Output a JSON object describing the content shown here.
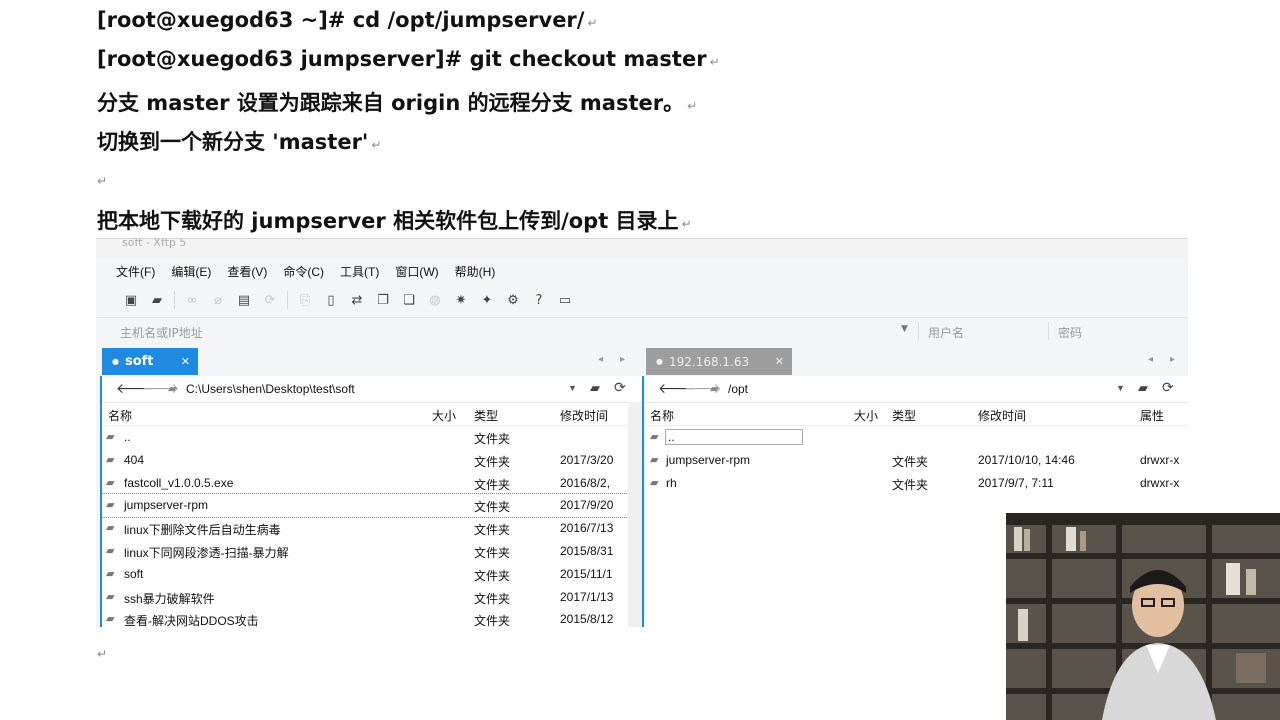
{
  "doc": {
    "line1": "[root@xuegod63 ~]# cd /opt/jumpserver/",
    "line2": "[root@xuegod63 jumpserver]# git checkout master",
    "line3": "分支 master 设置为跟踪来自 origin 的远程分支 master。",
    "line4": "切换到一个新分支 'master'",
    "line5": "把本地下载好的 jumpserver 相关软件包上传到/opt 目录上",
    "para_mark": "↵"
  },
  "xftp": {
    "title": "soft - Xftp 5",
    "menu": [
      "文件(F)",
      "编辑(E)",
      "查看(V)",
      "命令(C)",
      "工具(T)",
      "窗口(W)",
      "帮助(H)"
    ],
    "address": {
      "host_placeholder": "主机名或IP地址",
      "user_placeholder": "用户名",
      "password_placeholder": "密码"
    },
    "left": {
      "tab": "soft",
      "path": "C:\\Users\\shen\\Desktop\\test\\soft",
      "columns": {
        "name": "名称",
        "size": "大小",
        "type": "类型",
        "modified": "修改时间"
      },
      "rows": [
        {
          "name": "..",
          "type": "文件夹",
          "modified": ""
        },
        {
          "name": "404",
          "type": "文件夹",
          "modified": "2017/3/20"
        },
        {
          "name": "fastcoll_v1.0.0.5.exe",
          "type": "文件夹",
          "modified": "2016/8/2,"
        },
        {
          "name": "jumpserver-rpm",
          "type": "文件夹",
          "modified": "2017/9/20"
        },
        {
          "name": "linux下删除文件后自动生病毒",
          "type": "文件夹",
          "modified": "2016/7/13"
        },
        {
          "name": "linux下同网段渗透-扫描-暴力解",
          "type": "文件夹",
          "modified": "2015/8/31"
        },
        {
          "name": "soft",
          "type": "文件夹",
          "modified": "2015/11/1"
        },
        {
          "name": "ssh暴力破解软件",
          "type": "文件夹",
          "modified": "2017/1/13"
        },
        {
          "name": "查看-解决网站DDOS攻击",
          "type": "文件夹",
          "modified": "2015/8/12"
        }
      ]
    },
    "right": {
      "tab": "192.168.1.63",
      "path": "/opt",
      "columns": {
        "name": "名称",
        "size": "大小",
        "type": "类型",
        "modified": "修改时间",
        "attr": "属性"
      },
      "rows": [
        {
          "name": "..",
          "type": "",
          "modified": "",
          "attr": ""
        },
        {
          "name": "jumpserver-rpm",
          "type": "文件夹",
          "modified": "2017/10/10, 14:46",
          "attr": "drwxr-x"
        },
        {
          "name": "rh",
          "type": "文件夹",
          "modified": "2017/9/7, 7:11",
          "attr": "drwxr-x"
        }
      ]
    }
  }
}
